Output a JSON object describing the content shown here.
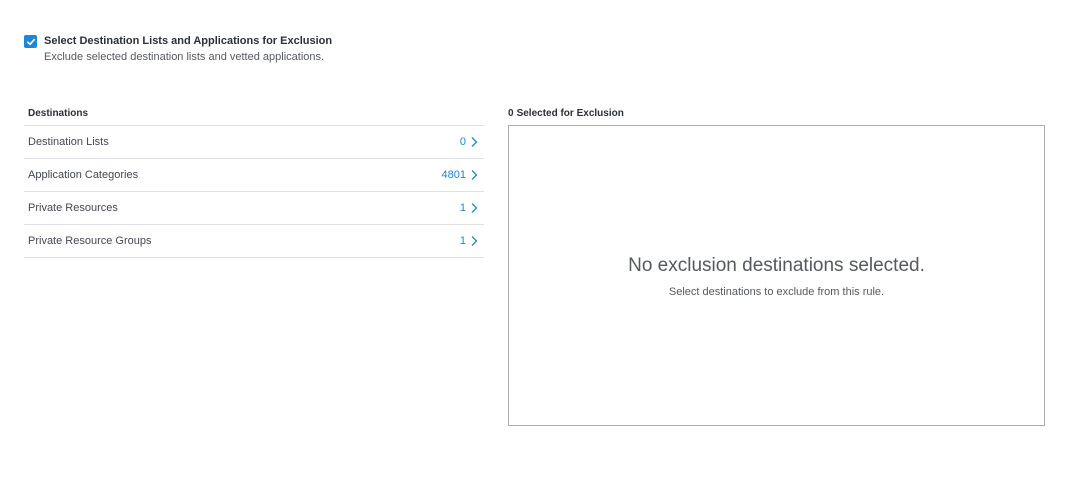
{
  "exclusion": {
    "checked": true,
    "title": "Select Destination Lists and Applications for Exclusion",
    "description": "Exclude selected destination lists and vetted applications."
  },
  "destinations": {
    "header": "Destinations",
    "items": [
      {
        "label": "Destination Lists",
        "count": "0"
      },
      {
        "label": "Application Categories",
        "count": "4801"
      },
      {
        "label": "Private Resources",
        "count": "1"
      },
      {
        "label": "Private Resource Groups",
        "count": "1"
      }
    ]
  },
  "selected": {
    "count": "0",
    "header_suffix": "Selected for Exclusion",
    "empty_title": "No exclusion destinations selected.",
    "empty_description": "Select destinations to exclude from this rule."
  },
  "colors": {
    "accent": "#1b87d6",
    "border": "#dfe1e4",
    "box_border": "#a9adb2"
  },
  "icons": {
    "checkbox": "check-icon",
    "row": "chevron-right-icon"
  }
}
